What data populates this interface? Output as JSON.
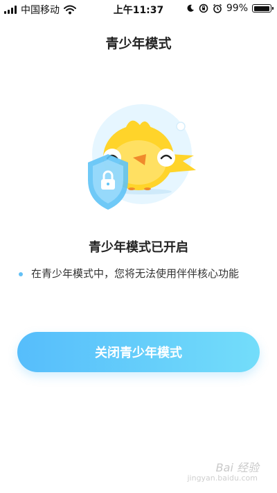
{
  "status_bar": {
    "carrier": "中国移动",
    "time": "上午11:37",
    "battery_percent": "99%",
    "battery_level": 0.99,
    "signal_bars": 4,
    "icons": [
      "signal-icon",
      "wifi-icon",
      "moon-icon",
      "rotation-lock-icon",
      "alarm-icon",
      "battery-icon"
    ]
  },
  "header": {
    "title": "青少年模式"
  },
  "main": {
    "illustration": {
      "icons": [
        "bird-mascot-icon",
        "shield-lock-icon"
      ]
    },
    "status_title": "青少年模式已开启",
    "notice": "在青少年模式中，您将无法使用伴伴核心功能",
    "close_button_label": "关闭青少年模式"
  },
  "watermark": {
    "text": "Bai 经验",
    "sub": "jingyan.baidu.com"
  },
  "colors": {
    "accent_start": "#56bdfb",
    "accent_end": "#73ddfa",
    "bullet": "#63c0f5",
    "bird": "#ffd42a",
    "shield": "#5fc3f6"
  }
}
